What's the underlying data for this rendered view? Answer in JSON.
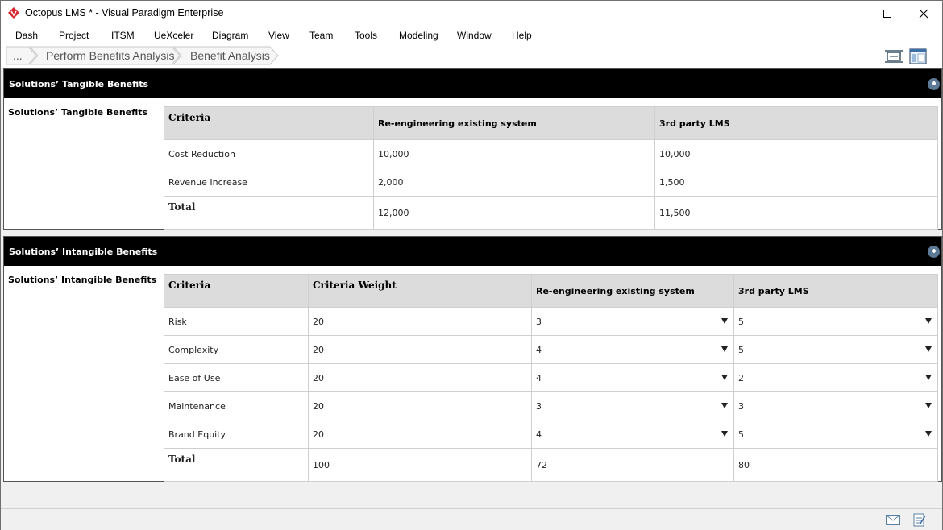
{
  "window": {
    "title": "Octopus LMS * - Visual Paradigm Enterprise"
  },
  "menu": [
    "Dash",
    "Project",
    "ITSM",
    "UeXceler",
    "Diagram",
    "View",
    "Team",
    "Tools",
    "Modeling",
    "Window",
    "Help"
  ],
  "breadcrumb": {
    "more": "...",
    "items": [
      "Perform Benefits Analysis",
      "Benefit Analysis"
    ]
  },
  "tangible": {
    "header": "Solutions’ Tangible Benefits",
    "label": "Solutions’ Tangible Benefits",
    "columns": [
      "Criteria",
      "Re-engineering existing system",
      "3rd party LMS"
    ],
    "rows": [
      [
        "Cost Reduction",
        "10,000",
        "10,000"
      ],
      [
        "Revenue Increase",
        "2,000",
        "1,500"
      ]
    ],
    "total": [
      "Total",
      "12,000",
      "11,500"
    ]
  },
  "intangible": {
    "header": "Solutions’ Intangible Benefits",
    "label": "Solutions’ Intangible Benefits",
    "columns": [
      "Criteria",
      "Criteria Weight",
      "Re-engineering existing system",
      "3rd party LMS"
    ],
    "rows": [
      [
        "Risk",
        "20",
        "3",
        "5"
      ],
      [
        "Complexity",
        "20",
        "4",
        "5"
      ],
      [
        "Ease of Use",
        "20",
        "4",
        "2"
      ],
      [
        "Maintenance",
        "20",
        "3",
        "3"
      ],
      [
        "Brand Equity",
        "20",
        "4",
        "5"
      ]
    ],
    "total": [
      "Total",
      "100",
      "72",
      "80"
    ]
  },
  "icons": {
    "app": "visual-paradigm-logo-icon",
    "minimize": "minimize-icon",
    "maximize": "maximize-icon",
    "close": "close-icon",
    "fit": "fit-to-window-icon",
    "layout": "page-layout-icon",
    "pin": "pin-icon",
    "mail": "mail-icon",
    "notes": "notes-icon"
  },
  "colors": {
    "panel_header": "#000000",
    "table_header": "#dcdcdc",
    "background": "#f0f0f0",
    "logo": "#d8262c",
    "pin": "#5c7a95"
  }
}
